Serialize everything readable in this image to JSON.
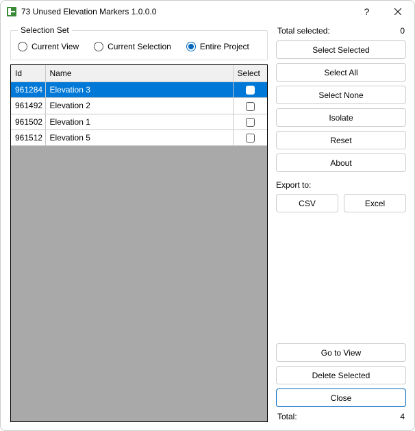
{
  "window": {
    "title": "73 Unused Elevation Markers 1.0.0.0"
  },
  "selection_set": {
    "legend": "Selection Set",
    "options": {
      "current_view": "Current View",
      "current_selection": "Current Selection",
      "entire_project": "Entire Project"
    },
    "selected": "entire_project"
  },
  "grid": {
    "headers": {
      "id": "Id",
      "name": "Name",
      "select": "Select"
    },
    "rows": [
      {
        "id": "961284",
        "name": "Elevation 3",
        "selected": true,
        "checked": false
      },
      {
        "id": "961492",
        "name": "Elevation 2",
        "selected": false,
        "checked": false
      },
      {
        "id": "961502",
        "name": "Elevation 1",
        "selected": false,
        "checked": false
      },
      {
        "id": "961512",
        "name": "Elevation 5",
        "selected": false,
        "checked": false
      }
    ]
  },
  "side": {
    "total_selected_label": "Total selected:",
    "total_selected_value": "0",
    "select_selected": "Select Selected",
    "select_all": "Select All",
    "select_none": "Select None",
    "isolate": "Isolate",
    "reset": "Reset",
    "about": "About",
    "export_label": "Export to:",
    "csv": "CSV",
    "excel": "Excel",
    "go_to_view": "Go to View",
    "delete_selected": "Delete Selected",
    "close": "Close",
    "total_label": "Total:",
    "total_value": "4"
  }
}
